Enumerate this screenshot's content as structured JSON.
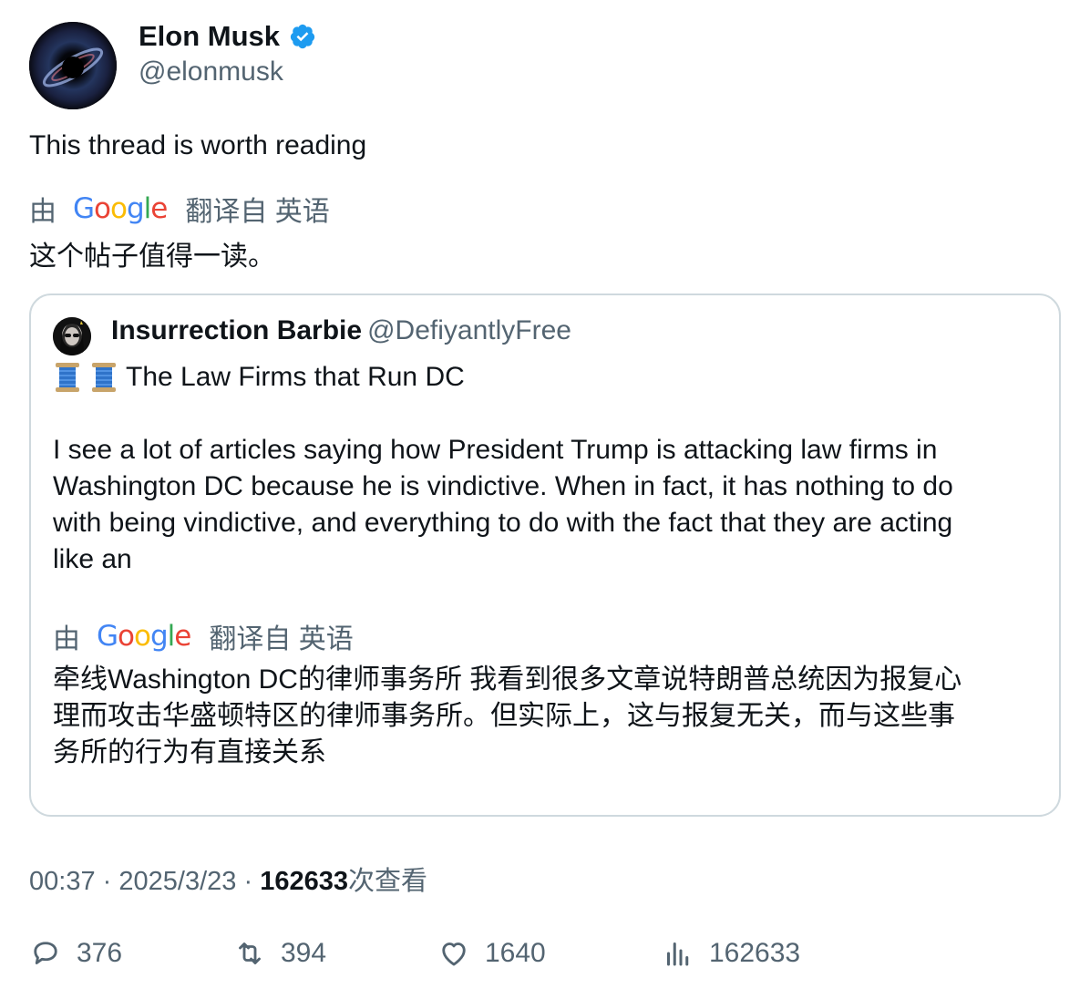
{
  "author": {
    "name": "Elon Musk",
    "handle": "@elonmusk",
    "verified_color": "#1d9bf0"
  },
  "tweet": {
    "text": "This thread is worth reading",
    "translation_prefix": "由",
    "translation_suffix": "翻译自 英语",
    "translated_text": "这个帖子值得一读。"
  },
  "quote": {
    "name": "Insurrection Barbie",
    "handle": "@DefiyantlyFree",
    "title_icon": "spool-of-thread-icon",
    "title": "The Law Firms that Run DC",
    "body_lines": [
      "I see a lot of articles saying how President Trump is attacking law firms in",
      "Washington DC because he is vindictive. When in fact, it has nothing to do",
      "with being vindictive, and everything to do with the fact that they are acting",
      "like an"
    ],
    "translation_prefix": "由",
    "translation_suffix": "翻译自 英语",
    "translated_lines": [
      "牵线Washington DC的律师事务所 我看到很多文章说特朗普总统因为报复心",
      "理而攻击华盛顿特区的律师事务所。但实际上，这与报复无关，而与这些事",
      "务所的行为有直接关系"
    ]
  },
  "meta": {
    "time": "00:37",
    "separator": "·",
    "date": "2025/3/23",
    "views_count": "162633",
    "views_label": "次查看"
  },
  "actions": {
    "replies": "376",
    "retweets": "394",
    "likes": "1640",
    "views": "162633"
  },
  "colors": {
    "text": "#0f1419",
    "secondary": "#536471",
    "border": "#cfd9de",
    "google_blue": "#4285f4",
    "google_red": "#ea4335",
    "google_yellow": "#fbbc05",
    "google_green": "#34a853"
  }
}
